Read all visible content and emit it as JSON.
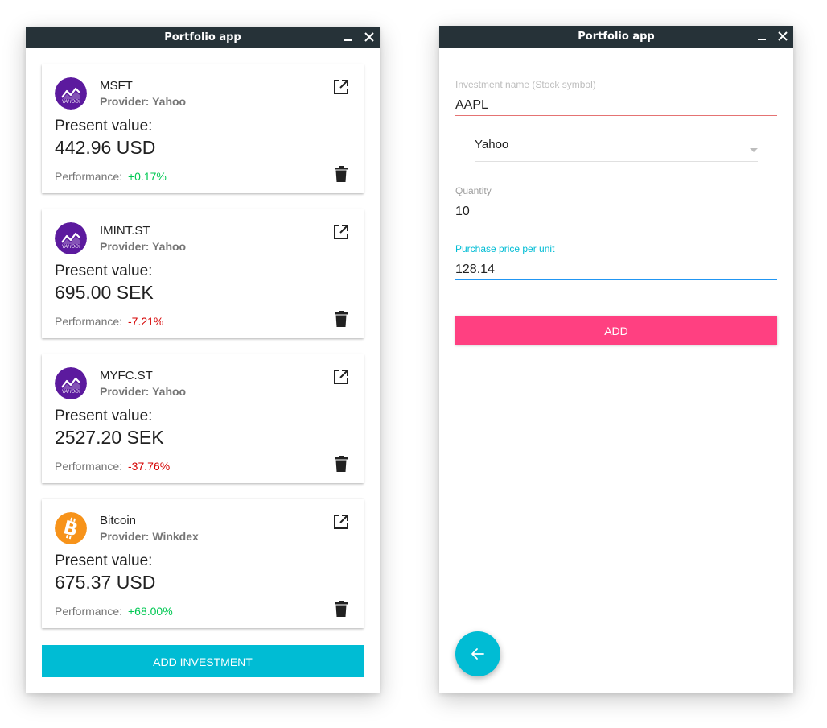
{
  "colors": {
    "titlebar": "#263238",
    "accent_cyan": "#00bcd4",
    "accent_pink": "#ff4081",
    "positive": "#00c853",
    "negative": "#d50000",
    "error_underline": "#e57373",
    "focus_underline": "#2196f3",
    "yahoo_purple": "#5c1a9e",
    "bitcoin_orange": "#f7931a"
  },
  "left_window": {
    "title": "Portfolio app",
    "investments": [
      {
        "name": "MSFT",
        "provider": "Provider: Yahoo",
        "logo": "yahoo-logo",
        "present_value_label": "Present value:",
        "present_value": "442.96 USD",
        "performance_label": "Performance:",
        "performance": "+0.17%",
        "trend": "positive"
      },
      {
        "name": "IMINT.ST",
        "provider": "Provider: Yahoo",
        "logo": "yahoo-logo",
        "present_value_label": "Present value:",
        "present_value": "695.00 SEK",
        "performance_label": "Performance:",
        "performance": "-7.21%",
        "trend": "negative"
      },
      {
        "name": "MYFC.ST",
        "provider": "Provider: Yahoo",
        "logo": "yahoo-logo",
        "present_value_label": "Present value:",
        "present_value": "2527.20 SEK",
        "performance_label": "Performance:",
        "performance": "-37.76%",
        "trend": "negative"
      },
      {
        "name": "Bitcoin",
        "provider": "Provider: Winkdex",
        "logo": "bitcoin-logo",
        "present_value_label": "Present value:",
        "present_value": "675.37 USD",
        "performance_label": "Performance:",
        "performance": "+68.00%",
        "trend": "positive"
      }
    ],
    "add_investment_label": "ADD INVESTMENT"
  },
  "right_window": {
    "title": "Portfolio app",
    "investment_name": {
      "label": "Investment name (Stock symbol)",
      "value": "AAPL"
    },
    "provider_select": {
      "selected": "Yahoo"
    },
    "quantity": {
      "label": "Quantity",
      "value": "10"
    },
    "purchase_price": {
      "label": "Purchase price per unit",
      "value": "128.14"
    },
    "add_label": "ADD",
    "back_icon": "arrow-back-icon"
  }
}
